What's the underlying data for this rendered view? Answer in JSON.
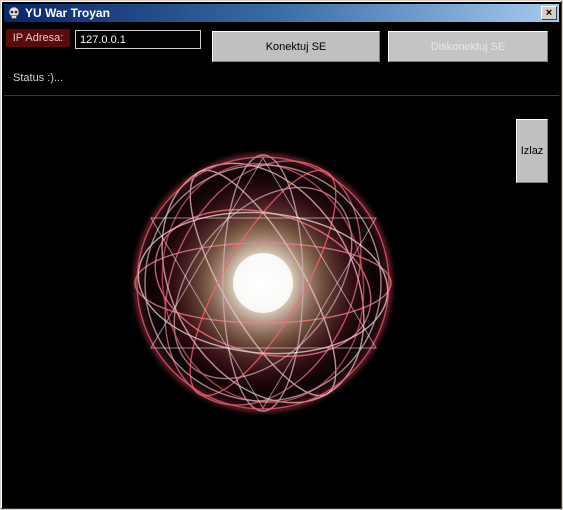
{
  "window": {
    "title": "YU War Troyan",
    "close_label": "×"
  },
  "form": {
    "ip_label": "IP Adresa:",
    "ip_value": "127.0.0.1",
    "connect_label": "Konektuj SE",
    "disconnect_label": "Diskonektuj SE",
    "status_text": "Status :)...",
    "exit_label": "Izlaz"
  },
  "icons": {
    "app": "skull-icon",
    "close": "close-icon",
    "artwork": "glowing-sphere-graphic"
  },
  "colors": {
    "titlebar_start": "#0a246a",
    "titlebar_end": "#a6caf0",
    "background": "#000000",
    "ip_label_bg": "#5a0a0a",
    "divider": "#9a1010",
    "button_face": "#c0c0c0"
  }
}
